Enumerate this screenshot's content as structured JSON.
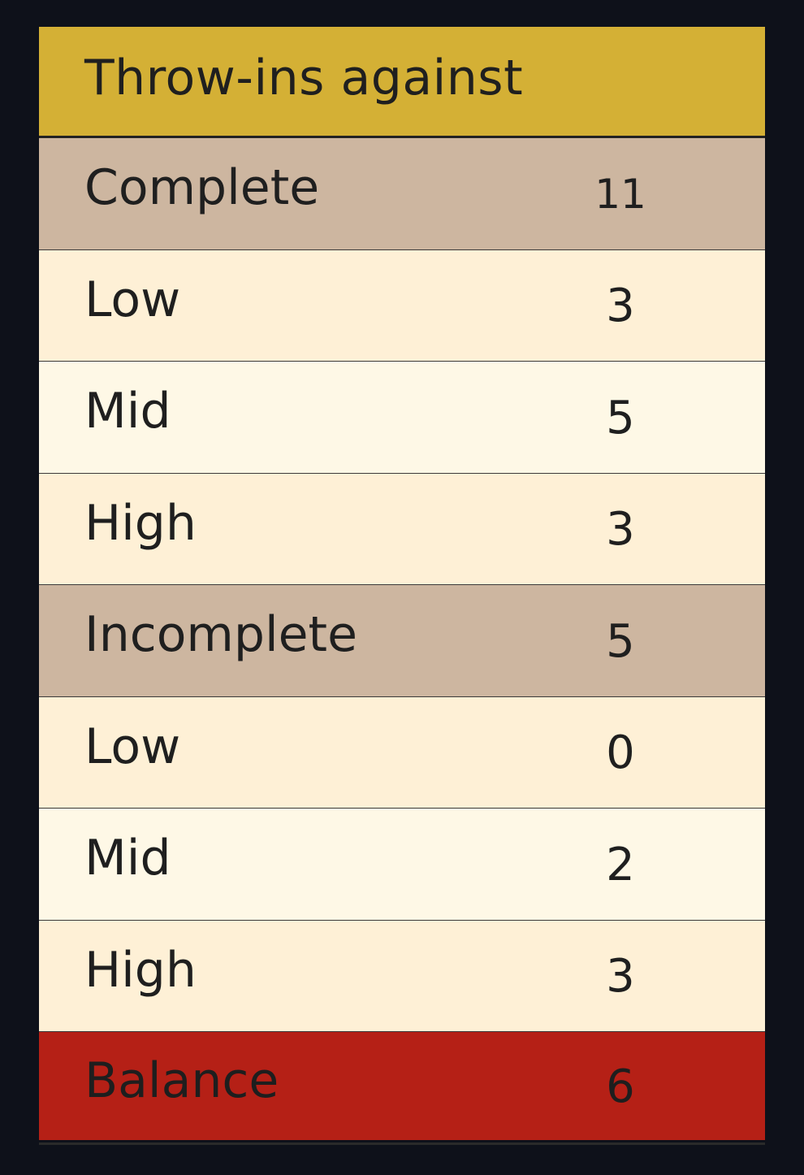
{
  "table": {
    "title": "Throw-ins against",
    "rows": [
      {
        "label": "Complete",
        "value": "11"
      },
      {
        "label": "Low",
        "value": "3"
      },
      {
        "label": "Mid",
        "value": "5"
      },
      {
        "label": "High",
        "value": "3"
      },
      {
        "label": "Incomplete",
        "value": "5"
      },
      {
        "label": "Low",
        "value": "0"
      },
      {
        "label": "Mid",
        "value": "2"
      },
      {
        "label": "High",
        "value": "3"
      },
      {
        "label": "Balance",
        "value": "6"
      }
    ]
  },
  "colors": {
    "header": "#d4b035",
    "group_row": "#cdb6a0",
    "sub_row_a": "#fef0d6",
    "sub_row_b": "#fef8e6",
    "balance_row": "#b52016",
    "background": "#0e111a"
  }
}
